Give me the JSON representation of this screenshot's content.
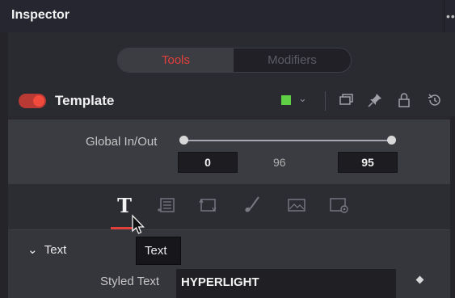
{
  "header": {
    "title": "Inspector",
    "more_label": "•••"
  },
  "tabs": [
    {
      "label": "Tools",
      "active": true
    },
    {
      "label": "Modifiers",
      "active": false
    }
  ],
  "template_row": {
    "label": "Template",
    "enabled": true,
    "color_chip": "#5fd046",
    "icons": [
      "window-icon",
      "pin-icon",
      "lock-icon",
      "reset-icon"
    ]
  },
  "global_in_out": {
    "label": "Global In/Out",
    "in_value": "0",
    "duration": "96",
    "out_value": "95"
  },
  "tool_icons": [
    {
      "name": "text-tool-icon",
      "active": true
    },
    {
      "name": "layout-tool-icon",
      "active": false
    },
    {
      "name": "transform-tool-icon",
      "active": false
    },
    {
      "name": "shading-tool-icon",
      "active": false
    },
    {
      "name": "image-tool-icon",
      "active": false
    },
    {
      "name": "settings-tool-icon",
      "active": false
    }
  ],
  "tooltip": {
    "text": "Text"
  },
  "text_section": {
    "header": "Text",
    "styled_text_label": "Styled Text",
    "styled_text_value": "HYPERLIGHT"
  },
  "colors": {
    "accent_red": "#e2403a",
    "chip_green": "#5fd046",
    "panel_bg": "#3b3b42"
  }
}
